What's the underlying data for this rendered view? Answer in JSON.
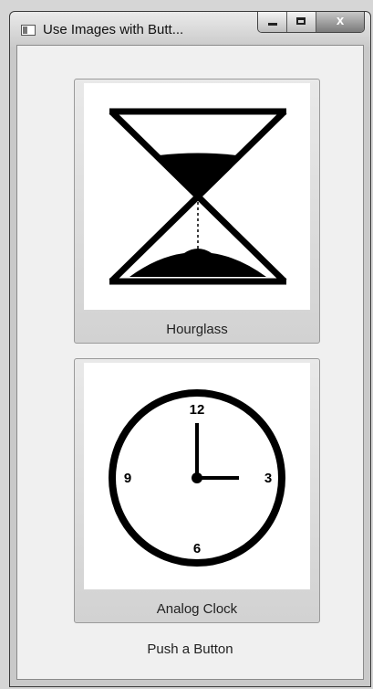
{
  "window": {
    "title": "Use Images with Butt...",
    "close_glyph": "x"
  },
  "buttons": [
    {
      "label": "Hourglass",
      "icon": "hourglass-icon"
    },
    {
      "label": "Analog Clock",
      "icon": "analog-clock-icon"
    }
  ],
  "clock_face": {
    "n12": "12",
    "n3": "3",
    "n6": "6",
    "n9": "9"
  },
  "status": "Push a Button"
}
